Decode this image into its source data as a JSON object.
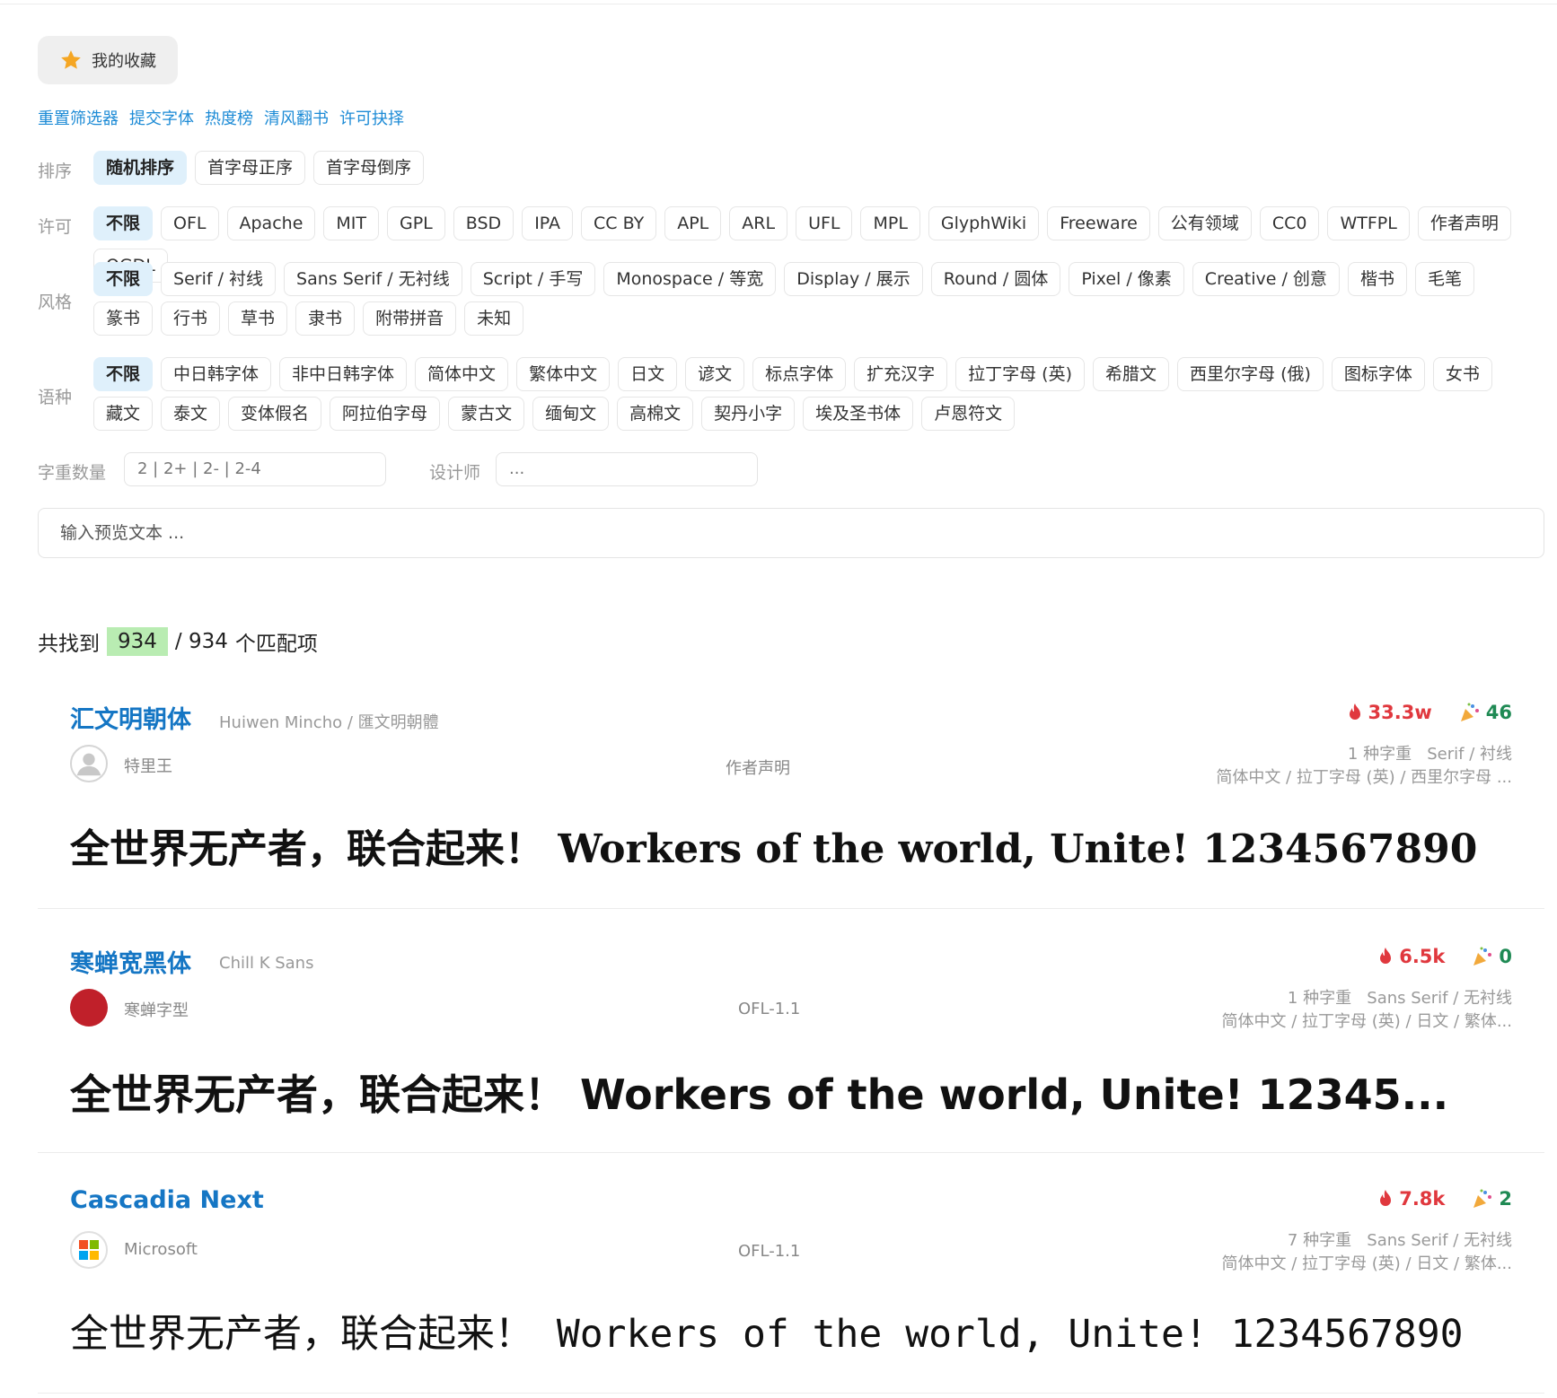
{
  "favorites": {
    "label": "我的收藏"
  },
  "links": [
    "重置筛选器",
    "提交字体",
    "热度榜",
    "清风翻书",
    "许可抉择"
  ],
  "sort": {
    "label": "排序",
    "options": [
      "随机排序",
      "首字母正序",
      "首字母倒序"
    ]
  },
  "license": {
    "label": "许可",
    "options": [
      "不限",
      "OFL",
      "Apache",
      "MIT",
      "GPL",
      "BSD",
      "IPA",
      "CC BY",
      "APL",
      "ARL",
      "UFL",
      "MPL",
      "GlyphWiki",
      "Freeware",
      "公有领域",
      "CC0",
      "WTFPL",
      "作者声明",
      "OGDL"
    ]
  },
  "style": {
    "label": "风格",
    "options": [
      "不限",
      "Serif / 衬线",
      "Sans Serif / 无衬线",
      "Script / 手写",
      "Monospace / 等宽",
      "Display / 展示",
      "Round / 圆体",
      "Pixel / 像素",
      "Creative / 创意",
      "楷书",
      "毛笔",
      "篆书",
      "行书",
      "草书",
      "隶书",
      "附带拼音",
      "未知"
    ]
  },
  "language": {
    "label": "语种",
    "options": [
      "不限",
      "中日韩字体",
      "非中日韩字体",
      "简体中文",
      "繁体中文",
      "日文",
      "谚文",
      "标点字体",
      "扩充汉字",
      "拉丁字母 (英)",
      "希腊文",
      "西里尔字母 (俄)",
      "图标字体",
      "女书",
      "藏文",
      "泰文",
      "变体假名",
      "阿拉伯字母",
      "蒙古文",
      "缅甸文",
      "高棉文",
      "契丹小字",
      "埃及圣书体",
      "卢恩符文"
    ]
  },
  "weight_filter": {
    "label": "字重数量",
    "value": "2 | 2+ | 2- | 2-4"
  },
  "designer_filter": {
    "label": "设计师",
    "value": "..."
  },
  "preview_input": {
    "placeholder": "输入预览文本 ..."
  },
  "results": {
    "prefix": "共找到",
    "found": "934",
    "total": "/ 934",
    "suffix": "个匹配项"
  },
  "fonts": [
    {
      "name": "汇文明朝体",
      "alias": "Huiwen Mincho / 匯文明朝體",
      "author": "特里王",
      "license": "作者声明",
      "heat": "33.3w",
      "votes": "46",
      "weights": "1 种字重",
      "style": "Serif / 衬线",
      "languages": "简体中文 / 拉丁字母 (英) / 西里尔字母 ...",
      "sample": "全世界无产者，联合起来！ Workers of the world, Unite!  1234567890",
      "avatar_color": "#bdbdbd"
    },
    {
      "name": "寒蝉宽黑体",
      "alias": "Chill K Sans",
      "author": "寒蝉字型",
      "license": "OFL-1.1",
      "heat": "6.5k",
      "votes": "0",
      "weights": "1 种字重",
      "style": "Sans Serif / 无衬线",
      "languages": "简体中文 / 拉丁字母 (英) / 日文 / 繁体...",
      "sample": "全世界无产者，联合起来！  Workers of the world, Unite!  12345...",
      "avatar_color": "#c0202a"
    },
    {
      "name": "Cascadia Next",
      "alias": "",
      "author": "Microsoft",
      "license": "OFL-1.1",
      "heat": "7.8k",
      "votes": "2",
      "weights": "7 种字重",
      "style": "Sans Serif / 无衬线",
      "languages": "简体中文 / 拉丁字母 (英) / 日文 / 繁体...",
      "sample": "全世界无产者，联合起来！ Workers of the world, Unite!  1234567890",
      "avatar_color": "#ffffff"
    }
  ],
  "colors": {
    "accent": "#1576c4",
    "link": "#1d8bd6",
    "hot": "#e0383e",
    "vote": "#1f8a54",
    "found_bg": "#b9ecb2"
  }
}
